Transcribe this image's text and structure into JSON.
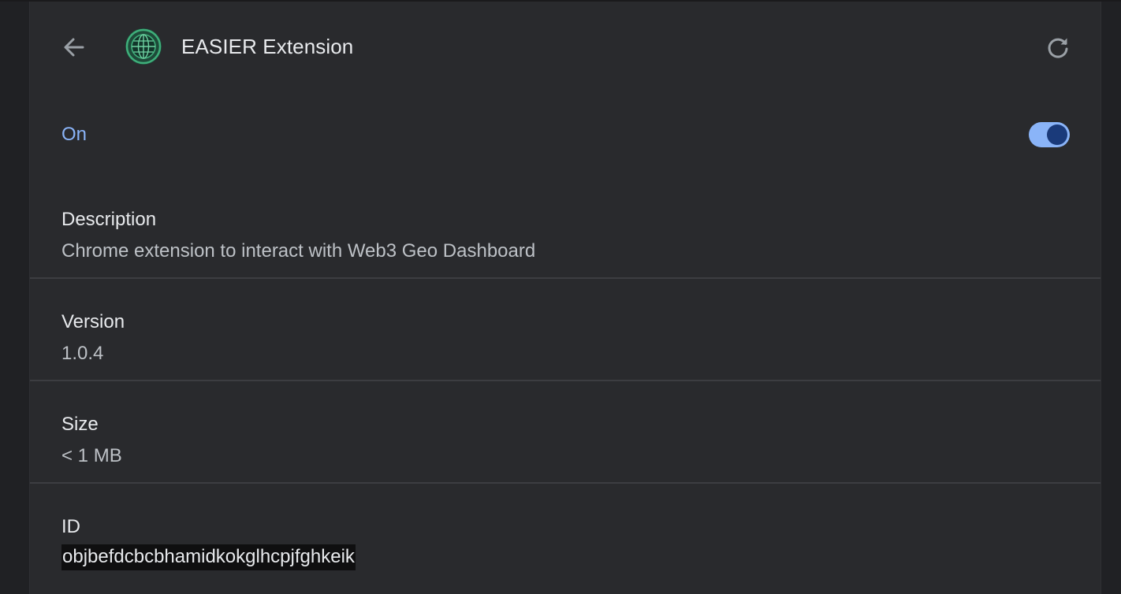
{
  "header": {
    "title": "EASIER Extension",
    "back_icon": "arrow-left-icon",
    "reload_icon": "reload-icon",
    "extension_icon": "globe-icon",
    "accent_color": "#3fae7a"
  },
  "status": {
    "label": "On",
    "enabled": true,
    "toggle_color": "#8ab4f8"
  },
  "details": {
    "description": {
      "label": "Description",
      "value": "Chrome extension to interact with Web3 Geo Dashboard"
    },
    "version": {
      "label": "Version",
      "value": "1.0.4"
    },
    "size": {
      "label": "Size",
      "value": "< 1 MB"
    },
    "id": {
      "label": "ID",
      "value": "objbefdcbcbhamidkokglhcpjfghkeik"
    }
  }
}
